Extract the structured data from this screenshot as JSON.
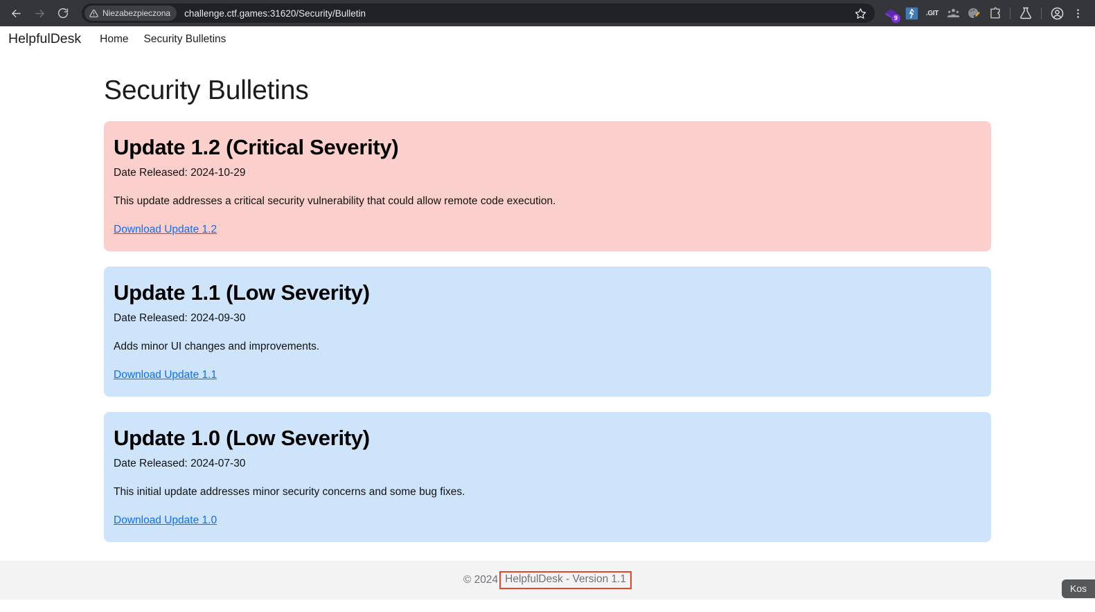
{
  "browser": {
    "back_label": "Back",
    "forward_label": "Forward",
    "reload_label": "Reload",
    "security_chip": "Niezabezpieczona",
    "url": "challenge.ctf.games:31620/Security/Bulletin",
    "bookmark_label": "Bookmark this tab",
    "extensions": [
      {
        "name": "extension-purple",
        "badge": "9"
      },
      {
        "name": "extension-blue",
        "badge": ""
      },
      {
        "name": "extension-git",
        "label": ".GIT"
      },
      {
        "name": "extension-people",
        "badge": ""
      },
      {
        "name": "extension-palette",
        "badge": ""
      },
      {
        "name": "extension-puzzle",
        "badge": ""
      },
      {
        "name": "extension-flask",
        "badge": ""
      }
    ],
    "profile_label": "Profile",
    "menu_label": "Customize and control Google Chrome"
  },
  "navbar": {
    "brand": "HelpfulDesk",
    "links": [
      {
        "label": "Home"
      },
      {
        "label": "Security Bulletins"
      }
    ]
  },
  "main": {
    "title": "Security Bulletins",
    "bulletins": [
      {
        "title": "Update 1.2 (Critical Severity)",
        "date": "Date Released: 2024-10-29",
        "description": "This update addresses a critical security vulnerability that could allow remote code execution.",
        "link": "Download Update 1.2",
        "severity": "critical",
        "color": "#fbcfcb"
      },
      {
        "title": "Update 1.1 (Low Severity)",
        "date": "Date Released: 2024-09-30",
        "description": "Adds minor UI changes and improvements.",
        "link": "Download Update 1.1",
        "severity": "low",
        "color": "#cde4fa"
      },
      {
        "title": "Update 1.0 (Low Severity)",
        "date": "Date Released: 2024-07-30",
        "description": "This initial update addresses minor security concerns and some bug fixes.",
        "link": "Download Update 1.0",
        "severity": "low",
        "color": "#cde4fa"
      }
    ]
  },
  "footer": {
    "copyright": "© 2024 ",
    "version": "HelpfulDesk - Version 1.1",
    "highlight_color": "#e8442a"
  },
  "status_tooltip": {
    "text": "Kos"
  }
}
